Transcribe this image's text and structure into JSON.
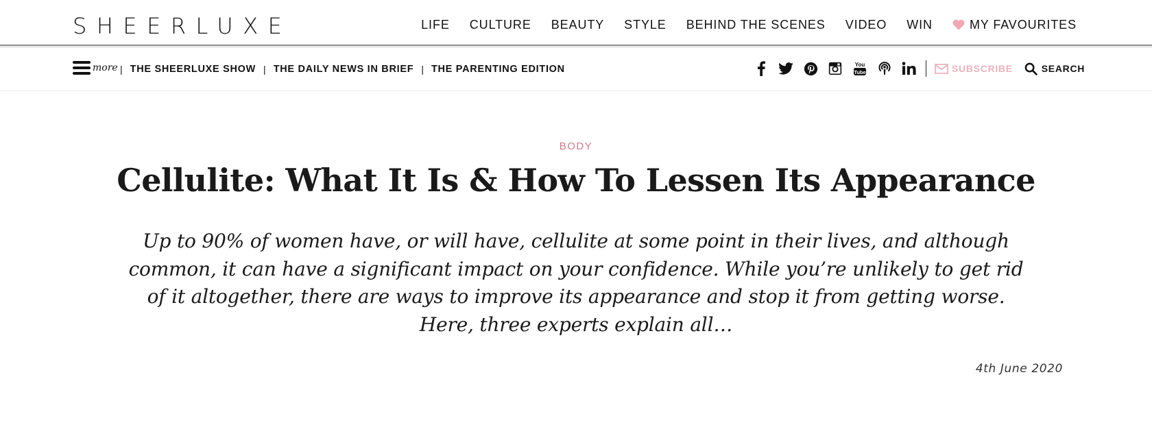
{
  "logo": "SHEERLUXE",
  "main_nav": [
    "LIFE",
    "CULTURE",
    "BEAUTY",
    "STYLE",
    "BEHIND THE SCENES",
    "VIDEO",
    "WIN"
  ],
  "favourites_label": "MY FAVOURITES",
  "menu_label": "more",
  "sub_nav": [
    "THE SHEERLUXE SHOW",
    "THE DAILY NEWS IN BRIEF",
    "THE PARENTING EDITION"
  ],
  "social_icons": [
    "facebook-icon",
    "twitter-icon",
    "pinterest-icon",
    "instagram-icon",
    "youtube-icon",
    "podcast-icon",
    "linkedin-icon"
  ],
  "subscribe_label": "SUBSCRIBE",
  "search_label": "SEARCH",
  "article": {
    "category": "BODY",
    "title": "Cellulite: What It Is & How To Lessen Its Appearance",
    "standfirst": "Up to 90% of women have, or will have, cellulite at some point in their lives, and although common, it can have a significant impact on your confidence. While you’re unlikely to get rid of it altogether, there are ways to improve its appearance and stop it from getting worse. Here, three experts explain all…",
    "date": "4th June 2020"
  },
  "colors": {
    "accent_pink": "#d17a88",
    "heart_pink": "#f2a7b4",
    "subscribe_pink": "#eab4bd",
    "text": "#1a1a1a"
  }
}
